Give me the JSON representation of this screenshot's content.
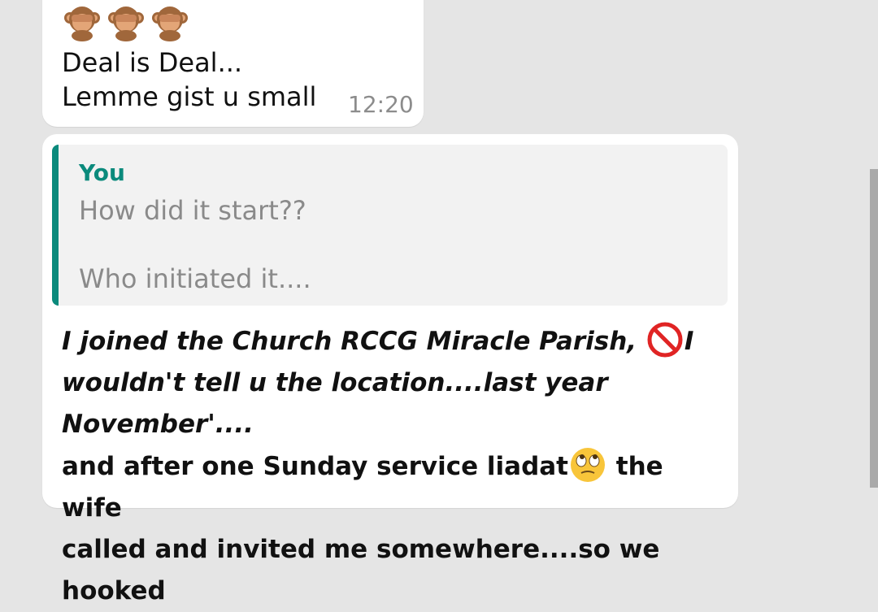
{
  "messages": [
    {
      "emoji_icons": [
        "see-no-evil-monkey-icon",
        "see-no-evil-monkey-icon",
        "see-no-evil-monkey-icon"
      ],
      "line1": "Deal is Deal...",
      "line2": "Lemme gist u small",
      "time": "12:20"
    },
    {
      "quote": {
        "author": "You",
        "line1": "How did it start??",
        "line2": "Who initiated it...."
      },
      "text": {
        "seg1": "I joined the Church RCCG Miracle Parish, ",
        "emoji1": "prohibited-icon",
        "seg2": "I",
        "seg3": "wouldn't tell u the location....last year November'....",
        "seg4": "and after one Sunday service liadat",
        "emoji2": "eye-roll-face-icon",
        "seg5": " the wife",
        "seg6": "called and invited me somewhere....so we hooked"
      }
    }
  ],
  "colors": {
    "background": "#e5e5e5",
    "bubble": "#ffffff",
    "quote_accent": "#0b8a7c",
    "quote_bg": "#f2f2f2",
    "timestamp": "#8c8c8c"
  }
}
